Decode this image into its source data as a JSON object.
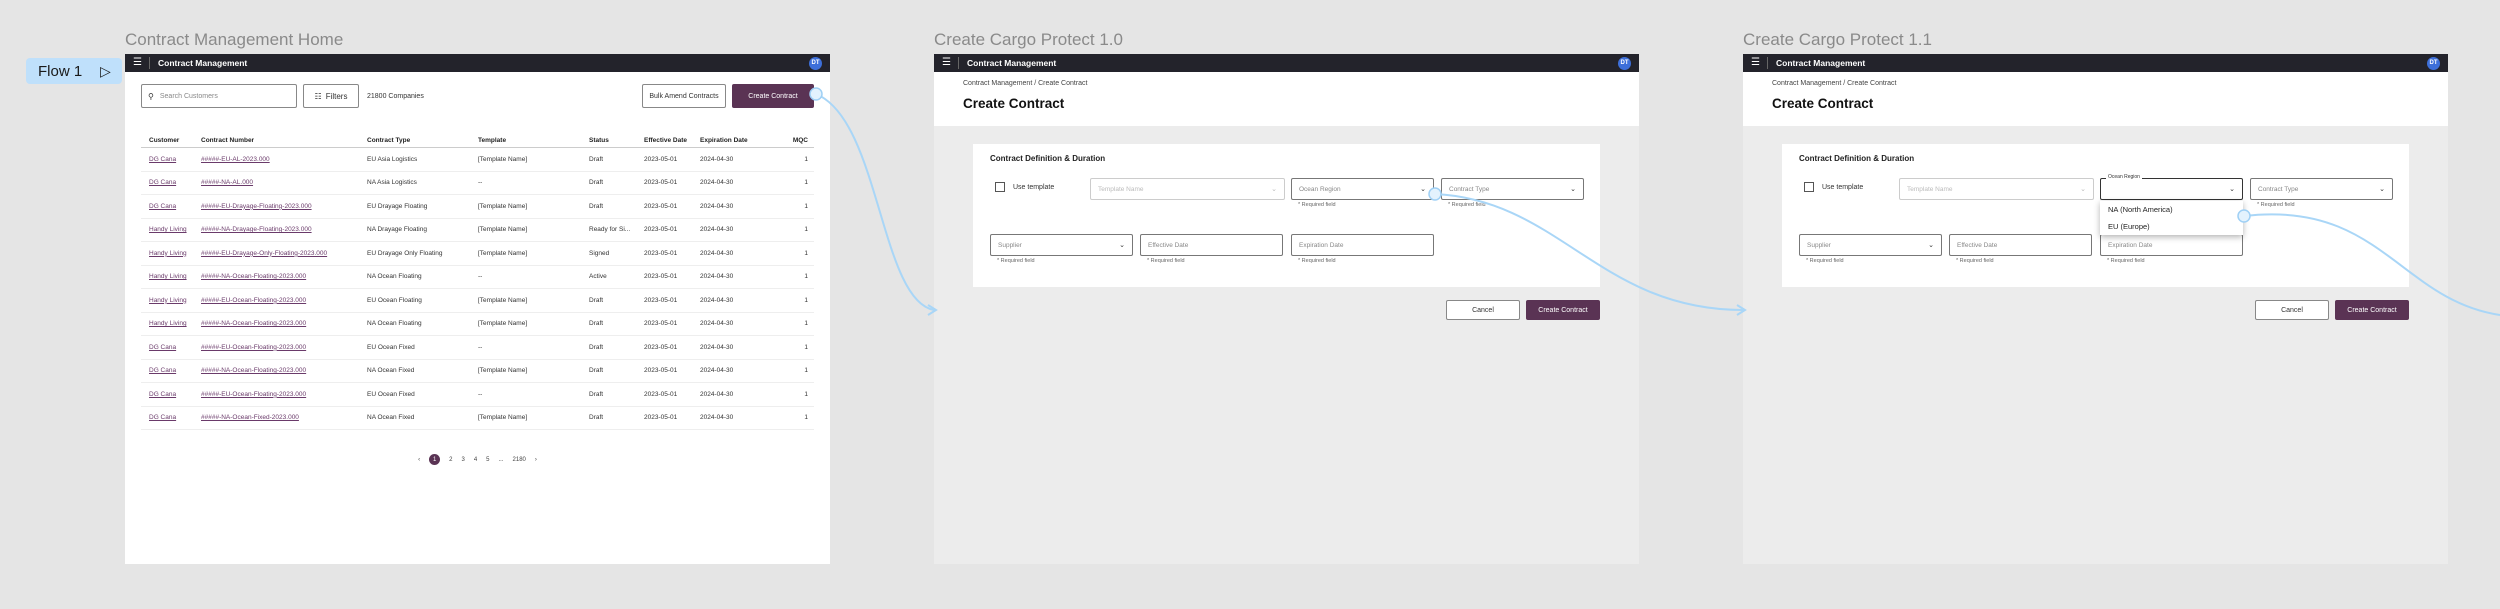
{
  "flow": {
    "label": "Flow 1"
  },
  "app": {
    "title": "Contract Management",
    "avatar": "DT"
  },
  "frames": [
    {
      "title": "Contract Management Home"
    },
    {
      "title": "Create Cargo Protect 1.0"
    },
    {
      "title": "Create Cargo Protect 1.1"
    }
  ],
  "home": {
    "search_placeholder": "Search Customers",
    "filters_label": "Filters",
    "company_count": "21800 Companies",
    "bulk_amend_label": "Bulk Amend Contracts",
    "create_label": "Create Contract",
    "columns": [
      "Customer",
      "Contract Number",
      "Contract Type",
      "Template",
      "Status",
      "Effective Date",
      "Expiration Date",
      "MQC"
    ],
    "rows": [
      [
        "DG Cana",
        "#####-EU-AL-2023.000",
        "EU Asia Logistics",
        "[Template Name]",
        "Draft",
        "2023-05-01",
        "2024-04-30",
        "1"
      ],
      [
        "DG Cana",
        "#####-NA-AL.000",
        "NA Asia Logistics",
        "--",
        "Draft",
        "2023-05-01",
        "2024-04-30",
        "1"
      ],
      [
        "DG Cana",
        "#####-EU-Drayage-Floating-2023.000",
        "EU Drayage Floating",
        "[Template Name]",
        "Draft",
        "2023-05-01",
        "2024-04-30",
        "1"
      ],
      [
        "Handy Living",
        "#####-NA-Drayage-Floating-2023.000",
        "NA Drayage Floating",
        "[Template Name]",
        "Ready for Si...",
        "2023-05-01",
        "2024-04-30",
        "1"
      ],
      [
        "Handy Living",
        "#####-EU-Drayage-Only-Floating-2023.000",
        "EU Drayage Only Floating",
        "[Template Name]",
        "Signed",
        "2023-05-01",
        "2024-04-30",
        "1"
      ],
      [
        "Handy Living",
        "#####-NA-Ocean-Floating-2023.000",
        "NA Ocean Floating",
        "--",
        "Active",
        "2023-05-01",
        "2024-04-30",
        "1"
      ],
      [
        "Handy Living",
        "#####-EU-Ocean-Floating-2023.000",
        "EU Ocean Floating",
        "[Template Name]",
        "Draft",
        "2023-05-01",
        "2024-04-30",
        "1"
      ],
      [
        "Handy Living",
        "#####-NA-Ocean-Floating-2023.000",
        "NA Ocean Floating",
        "[Template Name]",
        "Draft",
        "2023-05-01",
        "2024-04-30",
        "1"
      ],
      [
        "DG Cana",
        "#####-EU-Ocean-Floating-2023.000",
        "EU Ocean Fixed",
        "--",
        "Draft",
        "2023-05-01",
        "2024-04-30",
        "1"
      ],
      [
        "DG Cana",
        "#####-NA-Ocean-Floating-2023.000",
        "NA Ocean Fixed",
        "[Template Name]",
        "Draft",
        "2023-05-01",
        "2024-04-30",
        "1"
      ],
      [
        "DG Cana",
        "#####-EU-Ocean-Floating-2023.000",
        "EU Ocean Fixed",
        "--",
        "Draft",
        "2023-05-01",
        "2024-04-30",
        "1"
      ],
      [
        "DG Cana",
        "#####-NA-Ocean-Fixed-2023.000",
        "NA Ocean Fixed",
        "[Template Name]",
        "Draft",
        "2023-05-01",
        "2024-04-30",
        "1"
      ]
    ],
    "pager": {
      "prev": "‹",
      "pages": [
        "1",
        "2",
        "3",
        "4",
        "5",
        "...",
        "2180"
      ],
      "next": "›"
    }
  },
  "create": {
    "breadcrumb": "Contract Management / Create Contract",
    "title": "Create Contract",
    "section_title": "Contract Definition & Duration",
    "use_template": "Use template",
    "template_name": "Template Name",
    "ocean_region": "Ocean Region",
    "contract_type": "Contract Type",
    "supplier": "Supplier",
    "effective_date": "Effective Date",
    "expiration_date": "Expiration Date",
    "required": "* Required field",
    "cancel": "Cancel",
    "submit": "Create Contract",
    "dropdown_label": "Ocean Region",
    "dropdown_options": [
      "NA (North America)",
      "EU (Europe)"
    ]
  }
}
